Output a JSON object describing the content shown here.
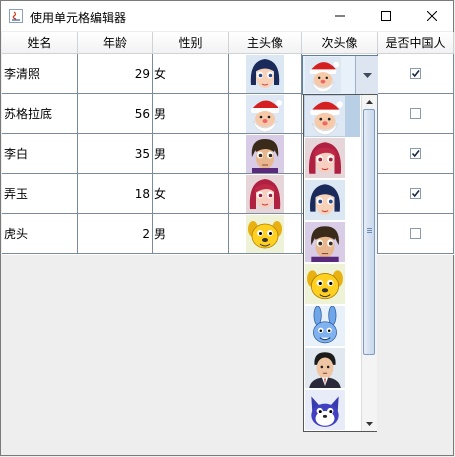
{
  "window": {
    "title": "使用单元格编辑器"
  },
  "table": {
    "columns": [
      "姓名",
      "年龄",
      "性别",
      "主头像",
      "次头像",
      "是否中国人"
    ],
    "rows": [
      {
        "name": "李清照",
        "age": "29",
        "gender": "女",
        "main_avatar": "girl-blue-hair-avatar",
        "second_avatar": "santa-avatar",
        "chinese": true
      },
      {
        "name": "苏格拉底",
        "age": "56",
        "gender": "男",
        "main_avatar": "santa-avatar",
        "second_avatar": "",
        "chinese": false
      },
      {
        "name": "李白",
        "age": "35",
        "gender": "男",
        "main_avatar": "boy-dark-hair-avatar",
        "second_avatar": "",
        "chinese": true
      },
      {
        "name": "弄玉",
        "age": "18",
        "gender": "女",
        "main_avatar": "girl-red-hair-avatar",
        "second_avatar": "",
        "chinese": true
      },
      {
        "name": "虎头",
        "age": "2",
        "gender": "男",
        "main_avatar": "yellow-dog-avatar",
        "second_avatar": "",
        "chinese": false
      }
    ]
  },
  "combo_popup": {
    "selected": "santa-avatar",
    "options": [
      "santa-avatar",
      "girl-red-hair-avatar",
      "girl-blue-hair-avatar",
      "boy-dark-hair-avatar",
      "yellow-dog-avatar",
      "blue-rabbit-avatar",
      "man-suit-avatar",
      "blue-cat-avatar"
    ]
  },
  "colors": {
    "selection": "#b8cfe5",
    "grid": "#7b8b9c",
    "window_bg": "#eeeeee"
  }
}
